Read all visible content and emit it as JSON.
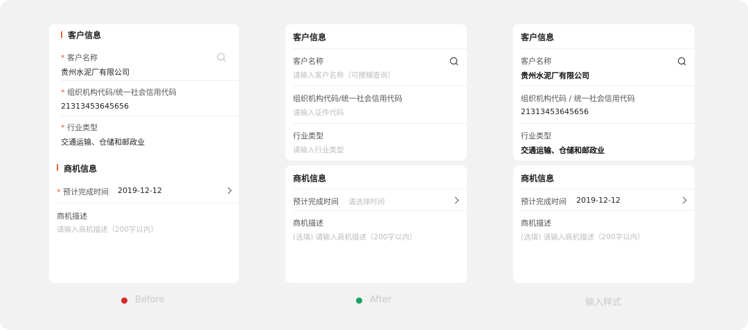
{
  "before": {
    "customer_section_title": "客户信息",
    "customer_name_label": "客户名称",
    "customer_name_value": "贵州水泥厂有限公司",
    "org_code_label": "组织机构代码/统一社会信用代码",
    "org_code_value": "21313453645656",
    "industry_label": "行业类型",
    "industry_value": "交通运输、仓储和邮政业",
    "opportunity_section_title": "商机信息",
    "completion_time_label": "预计完成时间",
    "completion_time_value": "2019-12-12",
    "description_label": "商机描述",
    "description_placeholder": "请输入商机描述（200字以内）",
    "required_mark": "*",
    "caption": "Before",
    "caption_dot_color": "#d42a2a"
  },
  "after": {
    "customer_section_title": "客户信息",
    "customer_name_label": "客户名称",
    "customer_name_placeholder": "请输入客户名称（可模糊查询）",
    "org_code_label": "组织机构代码/统一社会信用代码",
    "org_code_placeholder": "请输入证件代码",
    "industry_label": "行业类型",
    "industry_placeholder": "请输入行业类型",
    "opportunity_section_title": "商机信息",
    "completion_time_label": "预计完成时间",
    "completion_time_placeholder": "请选择时间",
    "description_label": "商机描述",
    "description_placeholder": "(选填) 请输入商机描述（200字以内）",
    "caption": "After",
    "caption_dot_color": "#1aa260"
  },
  "input_style": {
    "customer_section_title": "客户信息",
    "customer_name_label": "客户名称",
    "customer_name_value": "贵州水泥厂有限公司",
    "org_code_label": "组织机构代码 / 统一社会信用代码",
    "org_code_value": "21313453645656",
    "industry_label": "行业类型",
    "industry_value": "交通运输、仓储和邮政业",
    "opportunity_section_title": "商机信息",
    "completion_time_label": "预计完成时间",
    "completion_time_value": "2019-12-12",
    "description_label": "商机描述",
    "description_placeholder": "(选填) 请输入商机描述（200字以内）",
    "caption": "输入样式"
  },
  "colors": {
    "page_background": "#f2f2f2",
    "accent_bar": "#e6612e",
    "required_star": "#e25b2e",
    "placeholder": "#bdbdbd"
  }
}
